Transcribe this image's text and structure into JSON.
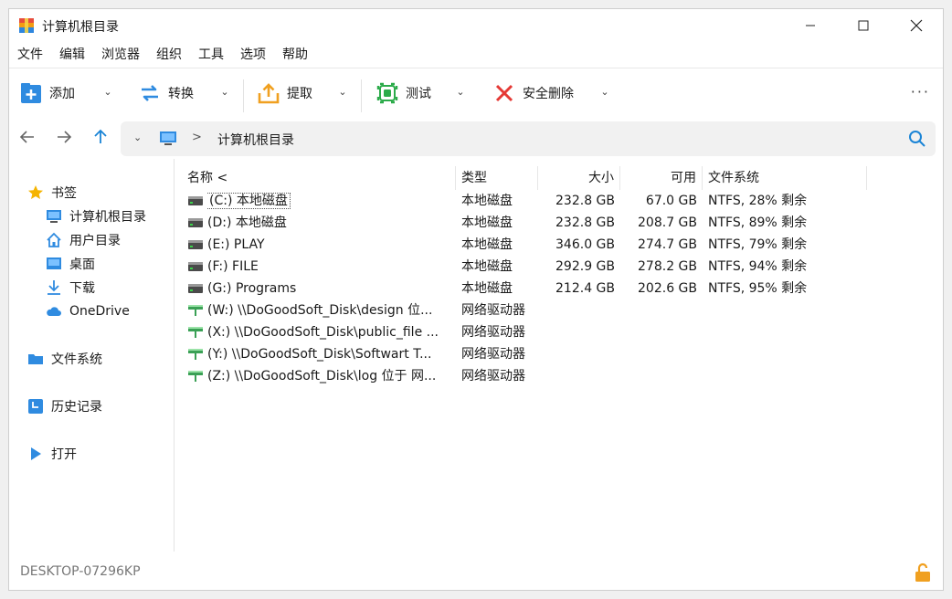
{
  "window": {
    "title": "计算机根目录"
  },
  "menu": [
    "文件",
    "编辑",
    "浏览器",
    "组织",
    "工具",
    "选项",
    "帮助"
  ],
  "toolbar": {
    "add": "添加",
    "convert": "转换",
    "extract": "提取",
    "test": "测试",
    "secure_delete": "安全删除",
    "more": "···"
  },
  "address": {
    "path": "计算机根目录"
  },
  "sidebar": {
    "bookmarks": "书签",
    "computer_root": "计算机根目录",
    "user_dir": "用户目录",
    "desktop": "桌面",
    "downloads": "下载",
    "onedrive": "OneDrive",
    "filesystem": "文件系统",
    "history": "历史记录",
    "open": "打开"
  },
  "columns": {
    "name": "名称 <",
    "type": "类型",
    "size": "大小",
    "free": "可用",
    "fs": "文件系统"
  },
  "drives": [
    {
      "name": "(C:) 本地磁盘",
      "type": "本地磁盘",
      "size": "232.8 GB",
      "free": "67.0 GB",
      "fs": "NTFS, 28% 剩余",
      "kind": "local"
    },
    {
      "name": "(D:) 本地磁盘",
      "type": "本地磁盘",
      "size": "232.8 GB",
      "free": "208.7 GB",
      "fs": "NTFS, 89% 剩余",
      "kind": "local"
    },
    {
      "name": "(E:) PLAY",
      "type": "本地磁盘",
      "size": "346.0 GB",
      "free": "274.7 GB",
      "fs": "NTFS, 79% 剩余",
      "kind": "local"
    },
    {
      "name": "(F:) FILE",
      "type": "本地磁盘",
      "size": "292.9 GB",
      "free": "278.2 GB",
      "fs": "NTFS, 94% 剩余",
      "kind": "local"
    },
    {
      "name": "(G:) Programs",
      "type": "本地磁盘",
      "size": "212.4 GB",
      "free": "202.6 GB",
      "fs": "NTFS, 95% 剩余",
      "kind": "local"
    },
    {
      "name": "(W:) \\\\DoGoodSoft_Disk\\design 位...",
      "type": "网络驱动器",
      "size": "",
      "free": "",
      "fs": "",
      "kind": "network"
    },
    {
      "name": "(X:) \\\\DoGoodSoft_Disk\\public_file ...",
      "type": "网络驱动器",
      "size": "",
      "free": "",
      "fs": "",
      "kind": "network"
    },
    {
      "name": "(Y:) \\\\DoGoodSoft_Disk\\Softwart T...",
      "type": "网络驱动器",
      "size": "",
      "free": "",
      "fs": "",
      "kind": "network"
    },
    {
      "name": "(Z:) \\\\DoGoodSoft_Disk\\log 位于 网...",
      "type": "网络驱动器",
      "size": "",
      "free": "",
      "fs": "",
      "kind": "network"
    }
  ],
  "status": {
    "computer": "DESKTOP-07296KP"
  },
  "colors": {
    "accent": "#1a84d6",
    "selection_outline": "#555555"
  }
}
